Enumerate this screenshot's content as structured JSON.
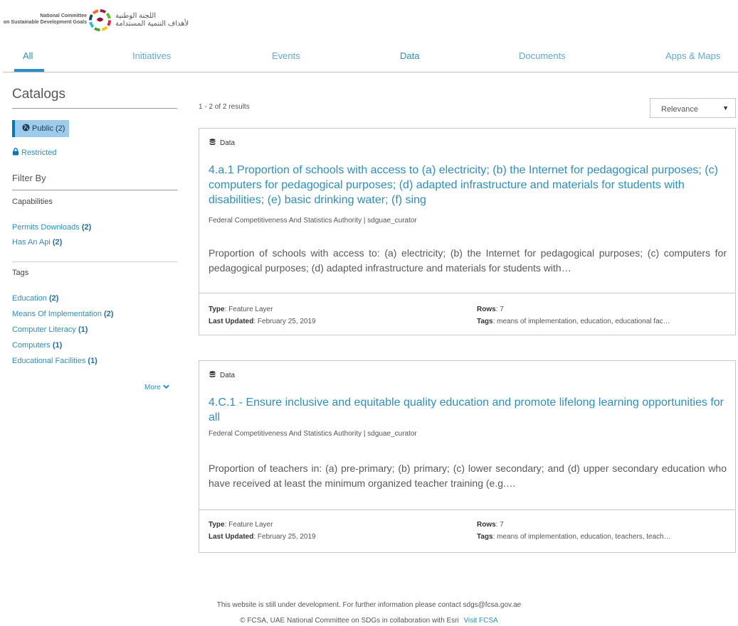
{
  "logo": {
    "en_line1": "National Committee",
    "en_line2": "on Sustainable Development Goals",
    "ar_line1": "اللجنة الوطنية",
    "ar_line2": "لأهداف التنمية المستدامة",
    "emblem_icon": "sdg-wheel-icon"
  },
  "tabs": [
    {
      "label": "All",
      "active": true
    },
    {
      "label": "Initiatives"
    },
    {
      "label": "Events"
    },
    {
      "label": "Data"
    },
    {
      "label": "Documents"
    },
    {
      "label": "Apps & Maps"
    }
  ],
  "sidebar": {
    "catalogs_title": "Catalogs",
    "catalogs": [
      {
        "label": "Public",
        "count": "(2)",
        "icon": "globe-icon",
        "active": true
      },
      {
        "label": "Restricted",
        "icon": "lock-icon"
      }
    ],
    "filter_by": "Filter By",
    "capabilities_title": "Capabilities",
    "capabilities": [
      {
        "label": "Permits Downloads",
        "count": "(2)"
      },
      {
        "label": "Has An Api",
        "count": "(2)"
      }
    ],
    "tags_title": "Tags",
    "tags": [
      {
        "label": "Education",
        "count": "(2)"
      },
      {
        "label": "Means Of Implementation",
        "count": "(2)"
      },
      {
        "label": "Computer Literacy",
        "count": "(1)"
      },
      {
        "label": "Computers",
        "count": "(1)"
      },
      {
        "label": "Educational Facilities",
        "count": "(1)"
      }
    ],
    "more_label": "More"
  },
  "results": {
    "count_text": "1 - 2 of 2 results",
    "sort_value": "Relevance",
    "items": [
      {
        "type_label": "Data",
        "title": "4.a.1 Proportion of schools with access to (a) electricity; (b) the Internet for pedagogical purposes; (c) computers for pedagogical purposes; (d) adapted infrastructure and materials for students with disabilities; (e) basic drinking water; (f) sing",
        "source": "Federal Competitiveness And Statistics Authority | sdguae_curator",
        "description": "Proportion of schools with access to: (a) electricity; (b) the Internet for pedagogical purposes; (c) computers for pedagogical purposes; (d) adapted infrastructure and materials for students with…",
        "type_key": "Type",
        "type_value": ": Feature Layer",
        "updated_key": "Last Updated",
        "updated_value": ": February 25, 2019",
        "rows_key": "Rows",
        "rows_value": ": 7",
        "tags_key": "Tags",
        "tags_value": ": means of implementation, education, educational fac…"
      },
      {
        "type_label": "Data",
        "title": "4.C.1 - Ensure inclusive and equitable quality education and promote lifelong learning opportunities for all",
        "source": "Federal Competitiveness And Statistics Authority | sdguae_curator",
        "description": "Proportion of teachers in: (a) pre-primary; (b) primary; (c) lower secondary; and (d) upper secondary education who have received at least the minimum organized teacher training (e.g.…",
        "type_key": "Type",
        "type_value": ": Feature Layer",
        "updated_key": "Last Updated",
        "updated_value": ": February 25, 2019",
        "rows_key": "Rows",
        "rows_value": ": 7",
        "tags_key": "Tags",
        "tags_value": ": means of implementation, education, teachers, teach…"
      }
    ]
  },
  "footer": {
    "line1": "This website is still under development. For further information please contact sdgs@fcsa.gov.ae",
    "line2": "© FCSA, UAE National Committee on SDGs in collaboration with Esri",
    "link": "Visit FCSA"
  },
  "colors": {
    "accent": "#2a8fc7",
    "active_catalog_bg": "#9dcbe9"
  }
}
